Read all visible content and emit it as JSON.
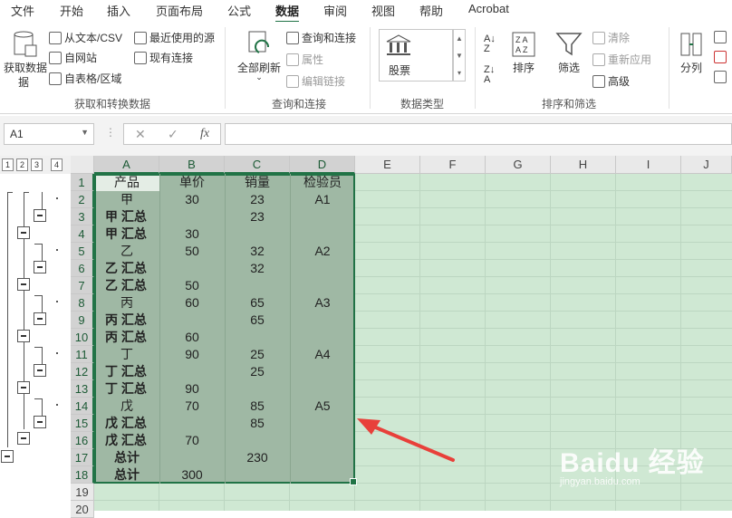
{
  "ribbon_tabs": [
    "文件",
    "开始",
    "插入",
    "页面布局",
    "公式",
    "数据",
    "审阅",
    "视图",
    "帮助",
    "Acrobat"
  ],
  "active_tab": "数据",
  "ribbon": {
    "get_transform": {
      "big_button": "获取数据",
      "big_button_line2": "据",
      "from_text_csv": "从文本/CSV",
      "from_web": "自网站",
      "from_table": "自表格/区域",
      "recent_sources": "最近使用的源",
      "existing_connections": "现有连接",
      "title": "获取和转换数据"
    },
    "queries": {
      "refresh_all": "全部刷新",
      "queries_connections": "查询和连接",
      "properties": "属性",
      "edit_links": "编辑链接",
      "title": "查询和连接"
    },
    "data_types": {
      "stocks": "股票",
      "title": "数据类型"
    },
    "sort_filter": {
      "sort": "排序",
      "filter": "筛选",
      "clear": "清除",
      "reapply": "重新应用",
      "advanced": "高级",
      "title": "排序和筛选"
    },
    "tools": {
      "split": "分列"
    }
  },
  "formula_bar": {
    "name_box": "A1",
    "cancel": "✕",
    "enter": "✓",
    "fx": "fx",
    "formula": ""
  },
  "outline_levels": [
    "1",
    "2",
    "3",
    "4"
  ],
  "columns": [
    "A",
    "B",
    "C",
    "D",
    "E",
    "F",
    "G",
    "H",
    "I",
    "J"
  ],
  "row_numbers": [
    "1",
    "2",
    "3",
    "4",
    "5",
    "6",
    "7",
    "8",
    "9",
    "10",
    "11",
    "12",
    "13",
    "14",
    "15",
    "16",
    "17",
    "18",
    "19",
    "20"
  ],
  "cells": {
    "r1": [
      "产品",
      "单价",
      "销量",
      "检验员"
    ],
    "r2": [
      "甲",
      "30",
      "23",
      "A1"
    ],
    "r3": [
      "甲 汇总",
      "",
      "23",
      ""
    ],
    "r4": [
      "甲 汇总",
      "30",
      "",
      ""
    ],
    "r5": [
      "乙",
      "50",
      "32",
      "A2"
    ],
    "r6": [
      "乙 汇总",
      "",
      "32",
      ""
    ],
    "r7": [
      "乙 汇总",
      "50",
      "",
      ""
    ],
    "r8": [
      "丙",
      "60",
      "65",
      "A3"
    ],
    "r9": [
      "丙 汇总",
      "",
      "65",
      ""
    ],
    "r10": [
      "丙 汇总",
      "60",
      "",
      ""
    ],
    "r11": [
      "丁",
      "90",
      "25",
      "A4"
    ],
    "r12": [
      "丁 汇总",
      "",
      "25",
      ""
    ],
    "r13": [
      "丁 汇总",
      "90",
      "",
      ""
    ],
    "r14": [
      "戊",
      "70",
      "85",
      "A5"
    ],
    "r15": [
      "戊 汇总",
      "",
      "85",
      ""
    ],
    "r16": [
      "戊 汇总",
      "70",
      "",
      ""
    ],
    "r17": [
      "总计",
      "",
      "230",
      ""
    ],
    "r18": [
      "总计",
      "300",
      "",
      ""
    ]
  },
  "watermark": {
    "main": "Baidu 经验",
    "sub": "jingyan.baidu.com"
  },
  "colors": {
    "excel_green": "#217346",
    "selection_fill": "#9fb8a4",
    "annotation_arrow": "#e8403a"
  }
}
